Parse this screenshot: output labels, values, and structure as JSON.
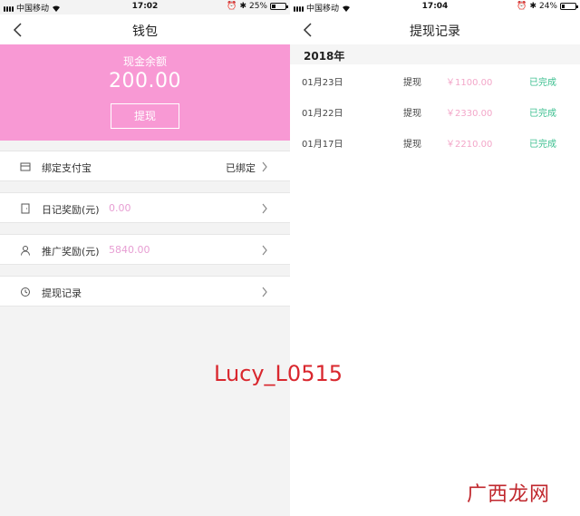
{
  "left": {
    "status": {
      "carrier": "中国移动",
      "time": "17:02",
      "battery": "25%",
      "battery_level": 0.25
    },
    "nav": {
      "title": "钱包"
    },
    "balance": {
      "label": "现金余额",
      "amount": "200.00",
      "button": "提现"
    },
    "rows": [
      {
        "icon": "card-icon",
        "label": "绑定支付宝",
        "value": "",
        "right": "已绑定"
      },
      {
        "icon": "door-icon",
        "label": "日记奖励(元)",
        "value": "0.00",
        "right": ""
      },
      {
        "icon": "person-icon",
        "label": "推广奖励(元)",
        "value": "5840.00",
        "right": ""
      },
      {
        "icon": "history-icon",
        "label": "提现记录",
        "value": "",
        "right": ""
      }
    ]
  },
  "right": {
    "status": {
      "carrier": "中国移动",
      "time": "17:04",
      "battery": "24%",
      "battery_level": 0.24
    },
    "nav": {
      "title": "提现记录"
    },
    "year": "2018年",
    "records": [
      {
        "date": "01月23日",
        "type": "提现",
        "amount": "￥1100.00",
        "status": "已完成"
      },
      {
        "date": "01月22日",
        "type": "提现",
        "amount": "￥2330.00",
        "status": "已完成"
      },
      {
        "date": "01月17日",
        "type": "提现",
        "amount": "￥2210.00",
        "status": "已完成"
      }
    ]
  },
  "overlay": {
    "watermark": "Lucy_L0515",
    "site": "广西龙网"
  },
  "colors": {
    "accent": "#f899d4",
    "value_pink": "#e79ed3",
    "amount_pink": "#f3a7c9",
    "success": "#3bbf8f"
  }
}
